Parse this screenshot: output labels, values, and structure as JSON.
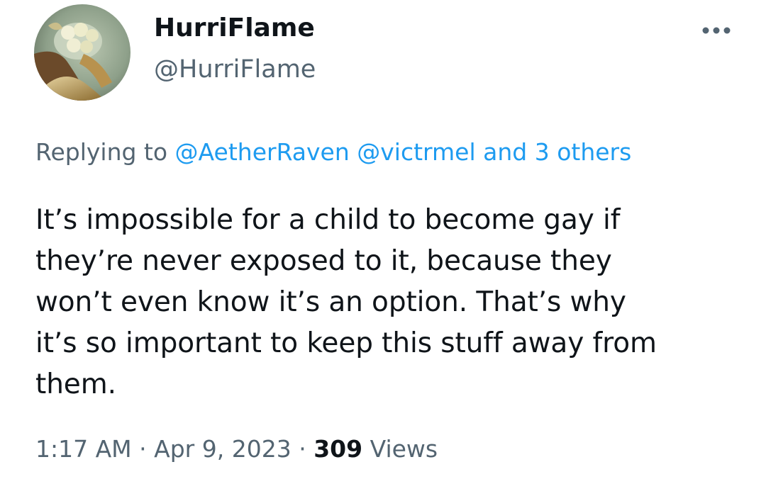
{
  "author": {
    "display_name": "HurriFlame",
    "handle": "@HurriFlame",
    "avatar_icon": "profile-avatar-image"
  },
  "menu": {
    "more_icon": "more-horizontal-icon"
  },
  "reply_context": {
    "prefix": "Replying to",
    "mention_1": "@AetherRaven",
    "mention_2": "@victrmel",
    "others": "and 3 others"
  },
  "tweet": {
    "line_1": "It’s impossible for a child to become gay if",
    "line_2": "they’re never exposed to it, because they",
    "line_3": "won’t even know it’s an option. That’s why",
    "line_4": "it’s so important to keep this stuff away from",
    "line_5": "them."
  },
  "meta": {
    "time": "1:17 AM",
    "separator": "·",
    "date": "Apr 9, 2023",
    "views_count": "309",
    "views_label": "Views"
  },
  "colors": {
    "text_primary": "#0f1419",
    "text_secondary": "#536471",
    "link": "#1d9bf0",
    "background": "#ffffff"
  }
}
